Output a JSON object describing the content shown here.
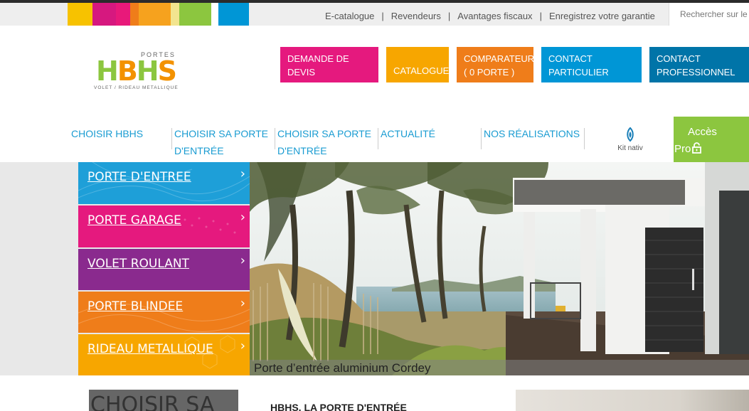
{
  "topbar": {
    "stripe_colors": [
      "#f7c200",
      "#d6187f",
      "#e8197a",
      "#ef7d1a",
      "#f6a21e",
      "#f2e48f",
      "#8cc63f",
      "#ffffff",
      "#0096d6"
    ],
    "links": [
      "E-catalogue",
      "Revendeurs",
      "Avantages fiscaux",
      "Enregistrez votre garantie"
    ],
    "separator": "|",
    "search_placeholder": "Rechercher sur le s"
  },
  "logo": {
    "top": "PORTES",
    "letters": [
      "H",
      "B",
      "H",
      "S"
    ],
    "letter_colors": [
      "#8cc63f",
      "#f39200",
      "#8cc63f",
      "#f39200"
    ],
    "tagline": "VOLET / RIDEAU  METALLIQUE"
  },
  "cta_buttons": [
    {
      "label": "DEMANDE DE DEVIS",
      "color": "#e5197e"
    },
    {
      "label": "CATALOGUE",
      "color": "#f7a600"
    },
    {
      "label": "COMPARATEUR ( 0 PORTE )",
      "color": "#ef7d1a"
    },
    {
      "label": "CONTACT PARTICULIER",
      "color": "#0096d6"
    },
    {
      "label": "CONTACT PROFESSIONNEL",
      "color": "#0074a8"
    }
  ],
  "nav": {
    "items": [
      "CHOISIR HBHS",
      "CHOISIR SA PORTE D'ENTRÉE",
      "CHOISIR SA PORTE D'ENTRÉE",
      "ACTUALITÉ",
      "NOS RÉALISATIONS"
    ],
    "kitnativ": "Kit nativ",
    "acces_line1": "Accès",
    "acces_line2": "Pro"
  },
  "side_menu": [
    {
      "label": "PORTE D'ENTREE",
      "color": "#1e9fd8"
    },
    {
      "label": "PORTE GARAGE",
      "color": "#e5197e"
    },
    {
      "label": "VOLET ROULANT",
      "color": "#8a2a8e"
    },
    {
      "label": "PORTE BLINDEE",
      "color": "#ef7d1a"
    },
    {
      "label": "RIDEAU METALLIQUE",
      "color": "#f7a600"
    }
  ],
  "hero": {
    "caption": "Porte d’entrée aluminium Cordey"
  },
  "bottom": {
    "title": "CHOISIR SA",
    "heading": "HBHS, LA PORTE D'ENTRÉE"
  }
}
